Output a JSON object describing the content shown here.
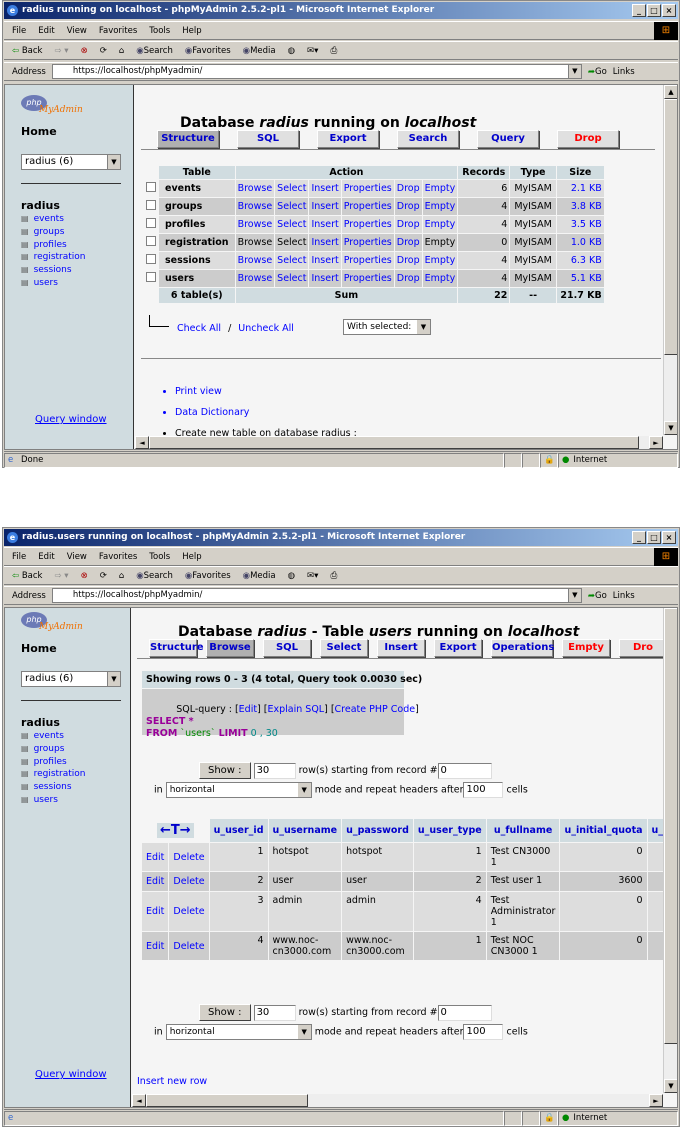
{
  "colors": {
    "title_bar": "#0a246a",
    "sidebar": "#d0dce0",
    "link": "#0000ff",
    "danger": "#ff0000",
    "header_cell": "#d0dce0"
  },
  "browser": {
    "menu": [
      "File",
      "Edit",
      "View",
      "Favorites",
      "Tools",
      "Help"
    ],
    "toolbar": {
      "back": "Back",
      "search": "Search",
      "favorites": "Favorites",
      "media": "Media"
    },
    "address_label": "Address",
    "go": "Go",
    "links": "Links",
    "zone": "Internet"
  },
  "window1": {
    "title": "radius running on localhost - phpMyAdmin 2.5.2-pl1 - Microsoft Internet Explorer",
    "url": "https://localhost/phpMyadmin/",
    "status": "Done",
    "sidebar": {
      "home": "Home",
      "db_select": "radius (6)",
      "db_name": "radius",
      "tables": [
        "events",
        "groups",
        "profiles",
        "registration",
        "sessions",
        "users"
      ],
      "query_window": "Query window"
    },
    "heading": {
      "prefix": "Database ",
      "db": "radius",
      "middle": " running on ",
      "host": "localhost"
    },
    "tabs": [
      {
        "label": "Structure",
        "active": true
      },
      {
        "label": "SQL"
      },
      {
        "label": "Export"
      },
      {
        "label": "Search"
      },
      {
        "label": "Query"
      },
      {
        "label": "Drop",
        "danger": true
      }
    ],
    "table": {
      "headers": [
        "Table",
        "Action",
        "Records",
        "Type",
        "Size"
      ],
      "actions": [
        "Browse",
        "Select",
        "Insert",
        "Properties",
        "Drop",
        "Empty"
      ],
      "rows": [
        {
          "name": "events",
          "records": "6",
          "type": "MyISAM",
          "size": "2.1 KB",
          "empty": false
        },
        {
          "name": "groups",
          "records": "4",
          "type": "MyISAM",
          "size": "3.8 KB",
          "empty": false
        },
        {
          "name": "profiles",
          "records": "4",
          "type": "MyISAM",
          "size": "3.5 KB",
          "empty": false
        },
        {
          "name": "registration",
          "records": "0",
          "type": "MyISAM",
          "size": "1.0 KB",
          "empty": true
        },
        {
          "name": "sessions",
          "records": "4",
          "type": "MyISAM",
          "size": "6.3 KB",
          "empty": false
        },
        {
          "name": "users",
          "records": "4",
          "type": "MyISAM",
          "size": "5.1 KB",
          "empty": false
        }
      ],
      "footer": {
        "count": "6 table(s)",
        "sum": "Sum",
        "records": "22",
        "type": "--",
        "size": "21.7 KB"
      }
    },
    "check_all": "Check All",
    "separator": "/",
    "uncheck_all": "Uncheck All",
    "with_selected": "With selected:",
    "bullets": [
      {
        "text": "Print view",
        "link": true
      },
      {
        "text": "Data Dictionary",
        "link": true
      },
      {
        "text": "Create new table on database radius :",
        "link": false
      }
    ]
  },
  "window2": {
    "title": "radius.users running on localhost - phpMyAdmin 2.5.2-pl1 - Microsoft Internet Explorer",
    "url": "https://localhost/phpMyadmin/",
    "status": "",
    "sidebar": {
      "home": "Home",
      "db_select": "radius (6)",
      "db_name": "radius",
      "tables": [
        "events",
        "groups",
        "profiles",
        "registration",
        "sessions",
        "users"
      ],
      "query_window": "Query window"
    },
    "heading": {
      "prefix": "Database ",
      "db": "radius",
      "middle": " - Table ",
      "table": "users",
      "middle2": " running on ",
      "host": "localhost"
    },
    "tabs": [
      {
        "label": "Structure"
      },
      {
        "label": "Browse",
        "active": true
      },
      {
        "label": "SQL"
      },
      {
        "label": "Select"
      },
      {
        "label": "Insert"
      },
      {
        "label": "Export"
      },
      {
        "label": "Operations"
      },
      {
        "label": "Empty",
        "danger": true
      },
      {
        "label": "Dro",
        "danger": true
      }
    ],
    "showing": "Showing rows 0 - 3 (4 total, Query took 0.0030 sec)",
    "sql": {
      "label": "SQL-query : ",
      "edit": "Edit",
      "explain": "Explain SQL",
      "php": "Create PHP Code",
      "line1_kw": "SELECT",
      "line1_rest": " *",
      "from": "FROM",
      "table": " `users` ",
      "limit": "LIMIT",
      "limit_vals": " 0 , 30"
    },
    "nav": {
      "show": "Show :",
      "rows": "30",
      "rows_label": "row(s) starting from record #",
      "start": "0",
      "in": "in",
      "mode": "horizontal",
      "mode_label": "mode and repeat headers after",
      "repeat": "100",
      "cells": "cells"
    },
    "grid": {
      "sort_icon": "←T→",
      "headers": [
        "u_user_id",
        "u_username",
        "u_password",
        "u_user_type",
        "u_fullname",
        "u_initial_quota",
        "u_cu"
      ],
      "edit": "Edit",
      "delete": "Delete",
      "rows": [
        [
          "1",
          "hotspot",
          "hotspot",
          "1",
          "Test CN3000 1",
          "0",
          ""
        ],
        [
          "2",
          "user",
          "user",
          "2",
          "Test user 1",
          "3600",
          ""
        ],
        [
          "3",
          "admin",
          "admin",
          "4",
          "Test Administrator 1",
          "0",
          ""
        ],
        [
          "4",
          "www.noc-cn3000.com",
          "www.noc-cn3000.com",
          "1",
          "Test NOC CN3000 1",
          "0",
          ""
        ]
      ]
    },
    "insert_row": "Insert new row"
  }
}
